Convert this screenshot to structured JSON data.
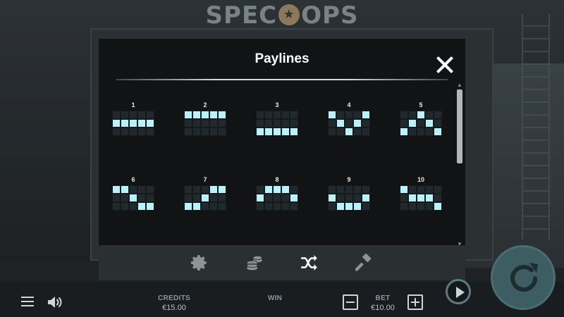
{
  "game": {
    "logo_left": "SPEC",
    "logo_badge": "★",
    "logo_right": "OPS"
  },
  "modal": {
    "title": "Paylines",
    "paylines": [
      {
        "number": "1",
        "rows": [
          1,
          1,
          1,
          1,
          1
        ]
      },
      {
        "number": "2",
        "rows": [
          0,
          0,
          0,
          0,
          0
        ]
      },
      {
        "number": "3",
        "rows": [
          2,
          2,
          2,
          2,
          2
        ]
      },
      {
        "number": "4",
        "rows": [
          0,
          1,
          2,
          1,
          0
        ]
      },
      {
        "number": "5",
        "rows": [
          2,
          1,
          0,
          1,
          2
        ]
      },
      {
        "number": "6",
        "rows": [
          0,
          0,
          1,
          2,
          2
        ]
      },
      {
        "number": "7",
        "rows": [
          2,
          2,
          1,
          0,
          0
        ]
      },
      {
        "number": "8",
        "rows": [
          1,
          0,
          0,
          0,
          1
        ]
      },
      {
        "number": "9",
        "rows": [
          1,
          2,
          2,
          2,
          1
        ]
      },
      {
        "number": "10",
        "rows": [
          0,
          1,
          1,
          1,
          2
        ]
      }
    ],
    "tabs": [
      {
        "icon": "gear-icon"
      },
      {
        "icon": "coins-icon"
      },
      {
        "icon": "shuffle-icon"
      },
      {
        "icon": "hammer-icon"
      }
    ]
  },
  "bottom_bar": {
    "credits_label": "CREDITS",
    "credits_value": "€15.00",
    "win_label": "WIN",
    "win_value": "",
    "bet_label": "BET",
    "bet_value": "€10.00"
  },
  "colors": {
    "payline_on": "#b8f2fb",
    "accent": "#4a6d72"
  }
}
